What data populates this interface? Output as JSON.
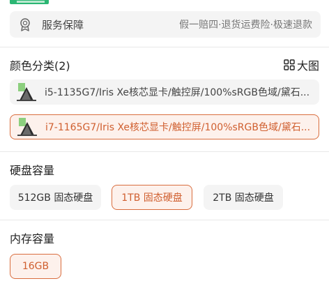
{
  "service": {
    "title": "服务保障",
    "desc": "假一赔四·退货运费险·极速退款"
  },
  "color_section": {
    "title": "颜色分类(2)",
    "big_image_label": "大图",
    "variants": [
      {
        "label": "i5-1135G7/Iris Xe核芯显卡/触控屏/100%sRGB色域/黛石...",
        "selected": false
      },
      {
        "label": "i7-1165G7/Iris Xe核芯显卡/触控屏/100%sRGB色域/黛石...",
        "selected": true
      }
    ]
  },
  "storage_section": {
    "title": "硬盘容量",
    "options": [
      {
        "label": "512GB 固态硬盘",
        "selected": false
      },
      {
        "label": "1TB 固态硬盘",
        "selected": true
      },
      {
        "label": "2TB 固态硬盘",
        "selected": false
      }
    ]
  },
  "memory_section": {
    "title": "内存容量",
    "options": [
      {
        "label": "16GB",
        "selected": true
      }
    ]
  },
  "colors": {
    "accent": "#d96d3e",
    "accent_bg": "#fdf1ec",
    "chip_bg": "#f4f4f4"
  }
}
